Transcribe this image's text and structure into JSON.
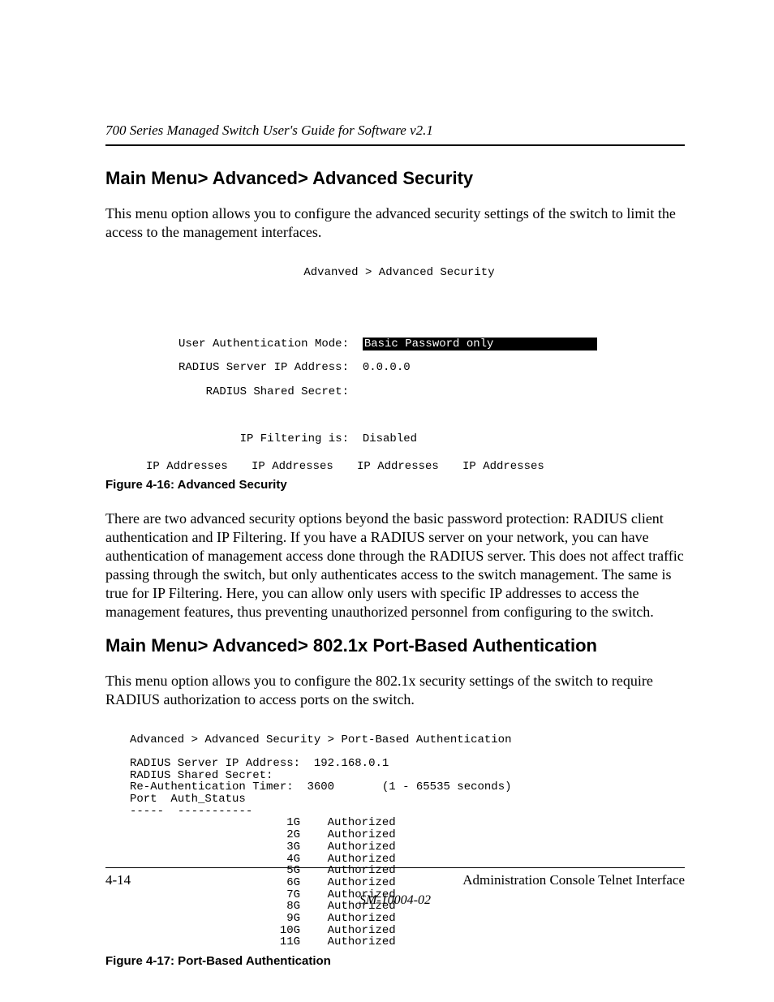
{
  "header": {
    "running": "700 Series Managed Switch User's Guide for Software v2.1"
  },
  "section1": {
    "heading": "Main Menu> Advanced> Advanced Security",
    "para1": "This menu option allows you to configure the advanced security settings of the switch to limit the access to the management interfaces.",
    "term": {
      "title": "Advanved > Advanced Security",
      "auth_mode_label": "User Authentication Mode:",
      "auth_mode_value": "Basic Password only",
      "radius_ip_label": "RADIUS Server IP Address:",
      "radius_ip_value": "0.0.0.0",
      "radius_secret_label": "RADIUS Shared Secret:",
      "filter_label": "IP Filtering is:",
      "filter_value": "Disabled",
      "ip_col": "IP Addresses"
    },
    "caption": "Figure 4-16:  Advanced Security",
    "para2": "There are two advanced security options beyond the basic password protection: RADIUS client authentication and IP Filtering.  If you have a RADIUS server on your network, you can have authentication of management access done through the RADIUS server.  This does not affect traffic passing through the switch, but only authenticates access to the switch management.  The same is true for IP Filtering.  Here, you can allow only users with specific IP addresses to access the management features, thus preventing unauthorized personnel from configuring to the switch."
  },
  "section2": {
    "heading": "Main Menu> Advanced> 802.1x Port-Based Authentication",
    "para1": "This menu option allows you to configure the 802.1x security settings of the switch to require RADIUS authorization to access ports on the switch.",
    "term": {
      "title": "Advanced > Advanced Security > Port-Based Authentication",
      "radius_ip_label": "RADIUS Server IP Address:",
      "radius_ip_value": "192.168.0.1",
      "radius_secret_label": "RADIUS Shared Secret:",
      "reauth_label": "Re-Authentication Timer:",
      "reauth_value": "3600",
      "reauth_range": "(1 - 65535 seconds)",
      "col_port": "Port",
      "col_status": "Auth_Status",
      "dash_port": "-----",
      "dash_status": "-----------",
      "rows": [
        {
          "port": "1G",
          "status": "Authorized"
        },
        {
          "port": "2G",
          "status": "Authorized"
        },
        {
          "port": "3G",
          "status": "Authorized"
        },
        {
          "port": "4G",
          "status": "Authorized"
        },
        {
          "port": "5G",
          "status": "Authorized"
        },
        {
          "port": "6G",
          "status": "Authorized"
        },
        {
          "port": "7G",
          "status": "Authorized"
        },
        {
          "port": "8G",
          "status": "Authorized"
        },
        {
          "port": "9G",
          "status": "Authorized"
        },
        {
          "port": "10G",
          "status": "Authorized"
        },
        {
          "port": "11G",
          "status": "Authorized"
        }
      ]
    },
    "caption": "Figure 4-17:  Port-Based Authentication"
  },
  "footer": {
    "page_num": "4-14",
    "right": "Administration Console Telnet Interface",
    "docnum": "SM-10004-02"
  }
}
